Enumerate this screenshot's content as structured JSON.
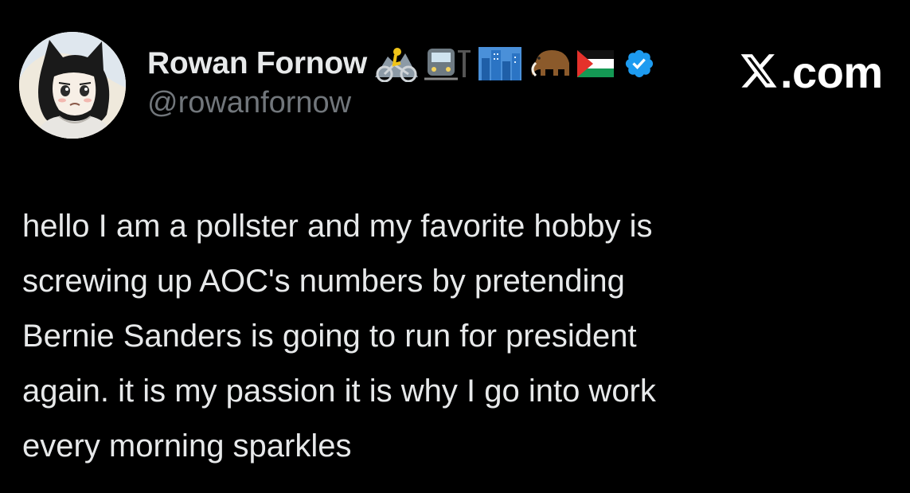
{
  "tweet": {
    "author": {
      "display_name": "Rowan Fornow",
      "handle": "@rowanfornow",
      "name_emojis": [
        "mountain-biker-icon",
        "train-icon",
        "cityscape-icon",
        "mammoth-icon",
        "palestine-flag-icon"
      ],
      "verified": true
    },
    "brand_label": ".com",
    "brand_icon": "x-logo-icon",
    "text": "hello I am a pollster and my favorite hobby is\nscrewing up AOC's numbers by pretending\nBernie Sanders is going to run for president\nagain. it is my passion it is why I go into work\nevery morning sparkles"
  },
  "colors": {
    "background": "#000000",
    "primary_text": "#e7e9ea",
    "secondary_text": "#71767b",
    "verified_badge": "#1d9bf0"
  }
}
